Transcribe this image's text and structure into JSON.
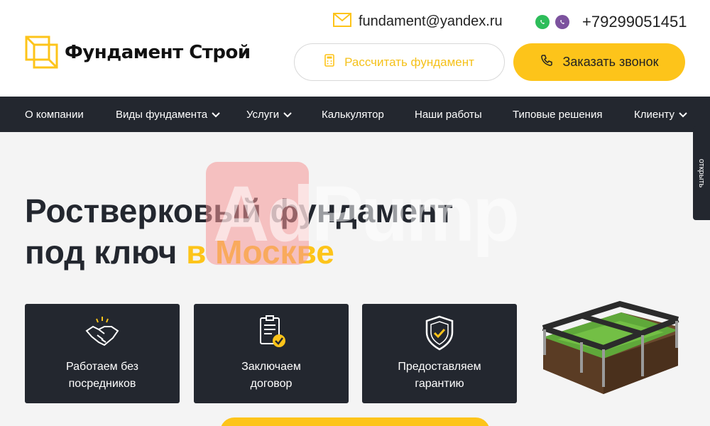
{
  "brand": {
    "name": "Фундамент Строй",
    "accent_color": "#fdc41a",
    "dark_color": "#23272f"
  },
  "header": {
    "email": "fundament@yandex.ru",
    "phone": "+79299051451",
    "calc_button_label": "Рассчитать фундамент",
    "call_button_label": "Заказать звонок",
    "icons": [
      "mail-icon",
      "whatsapp-icon",
      "viber-icon",
      "calculator-icon",
      "phone-icon"
    ]
  },
  "nav": {
    "items": [
      {
        "label": "О компании",
        "dropdown": false
      },
      {
        "label": "Виды фундамента",
        "dropdown": true
      },
      {
        "label": "Услуги",
        "dropdown": true
      },
      {
        "label": "Калькулятор",
        "dropdown": false
      },
      {
        "label": "Наши работы",
        "dropdown": false
      },
      {
        "label": "Типовые решения",
        "dropdown": false
      },
      {
        "label": "Клиенту",
        "dropdown": true
      }
    ]
  },
  "side_tab": {
    "label": "открыть"
  },
  "hero": {
    "title_line1": "Ростверковый фундамент",
    "title_line2_plain": "под ключ ",
    "title_line2_accent": "в Москве"
  },
  "watermark": {
    "text": "AdPump"
  },
  "features": [
    {
      "label": "Работаем без посредников",
      "icon": "handshake-icon"
    },
    {
      "label": "Заключаем договор",
      "icon": "contract-icon"
    },
    {
      "label": "Предоставляем гарантию",
      "icon": "shield-check-icon"
    }
  ]
}
